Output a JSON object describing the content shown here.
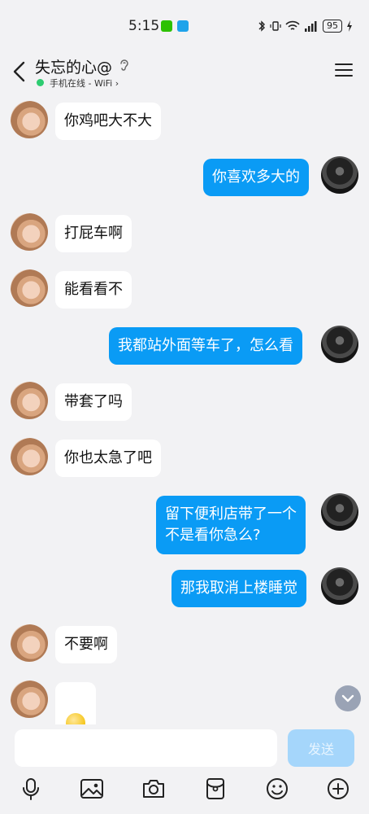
{
  "status_bar": {
    "time": "5:15",
    "battery": "95"
  },
  "header": {
    "name": "失忘的心@",
    "online_status": "手机在线 - WiFi"
  },
  "messages": [
    {
      "side": "left",
      "text": "你鸡吧大不大"
    },
    {
      "side": "right",
      "text": "你喜欢多大的"
    },
    {
      "side": "left",
      "text": "打屁车啊"
    },
    {
      "side": "left",
      "text": "能看看不"
    },
    {
      "side": "right",
      "text": "我都站外面等车了，怎么看"
    },
    {
      "side": "left",
      "text": "带套了吗"
    },
    {
      "side": "left",
      "text": "你也太急了吧"
    },
    {
      "side": "right",
      "text": "留下便利店带了一个\n不是看你急么?"
    },
    {
      "side": "right",
      "text": "那我取消上楼睡觉"
    },
    {
      "side": "left",
      "text": "不要啊"
    },
    {
      "side": "left",
      "emoji": "smirk-emoji"
    }
  ],
  "input": {
    "placeholder": "",
    "send_label": "发送"
  },
  "toolbar": [
    "microphone-icon",
    "image-icon",
    "camera-icon",
    "red-packet-icon",
    "emoji-icon",
    "plus-icon"
  ],
  "colors": {
    "accent": "#0a9bf5",
    "send_disabled": "#a5d6fb",
    "background": "#f2f2f4"
  }
}
